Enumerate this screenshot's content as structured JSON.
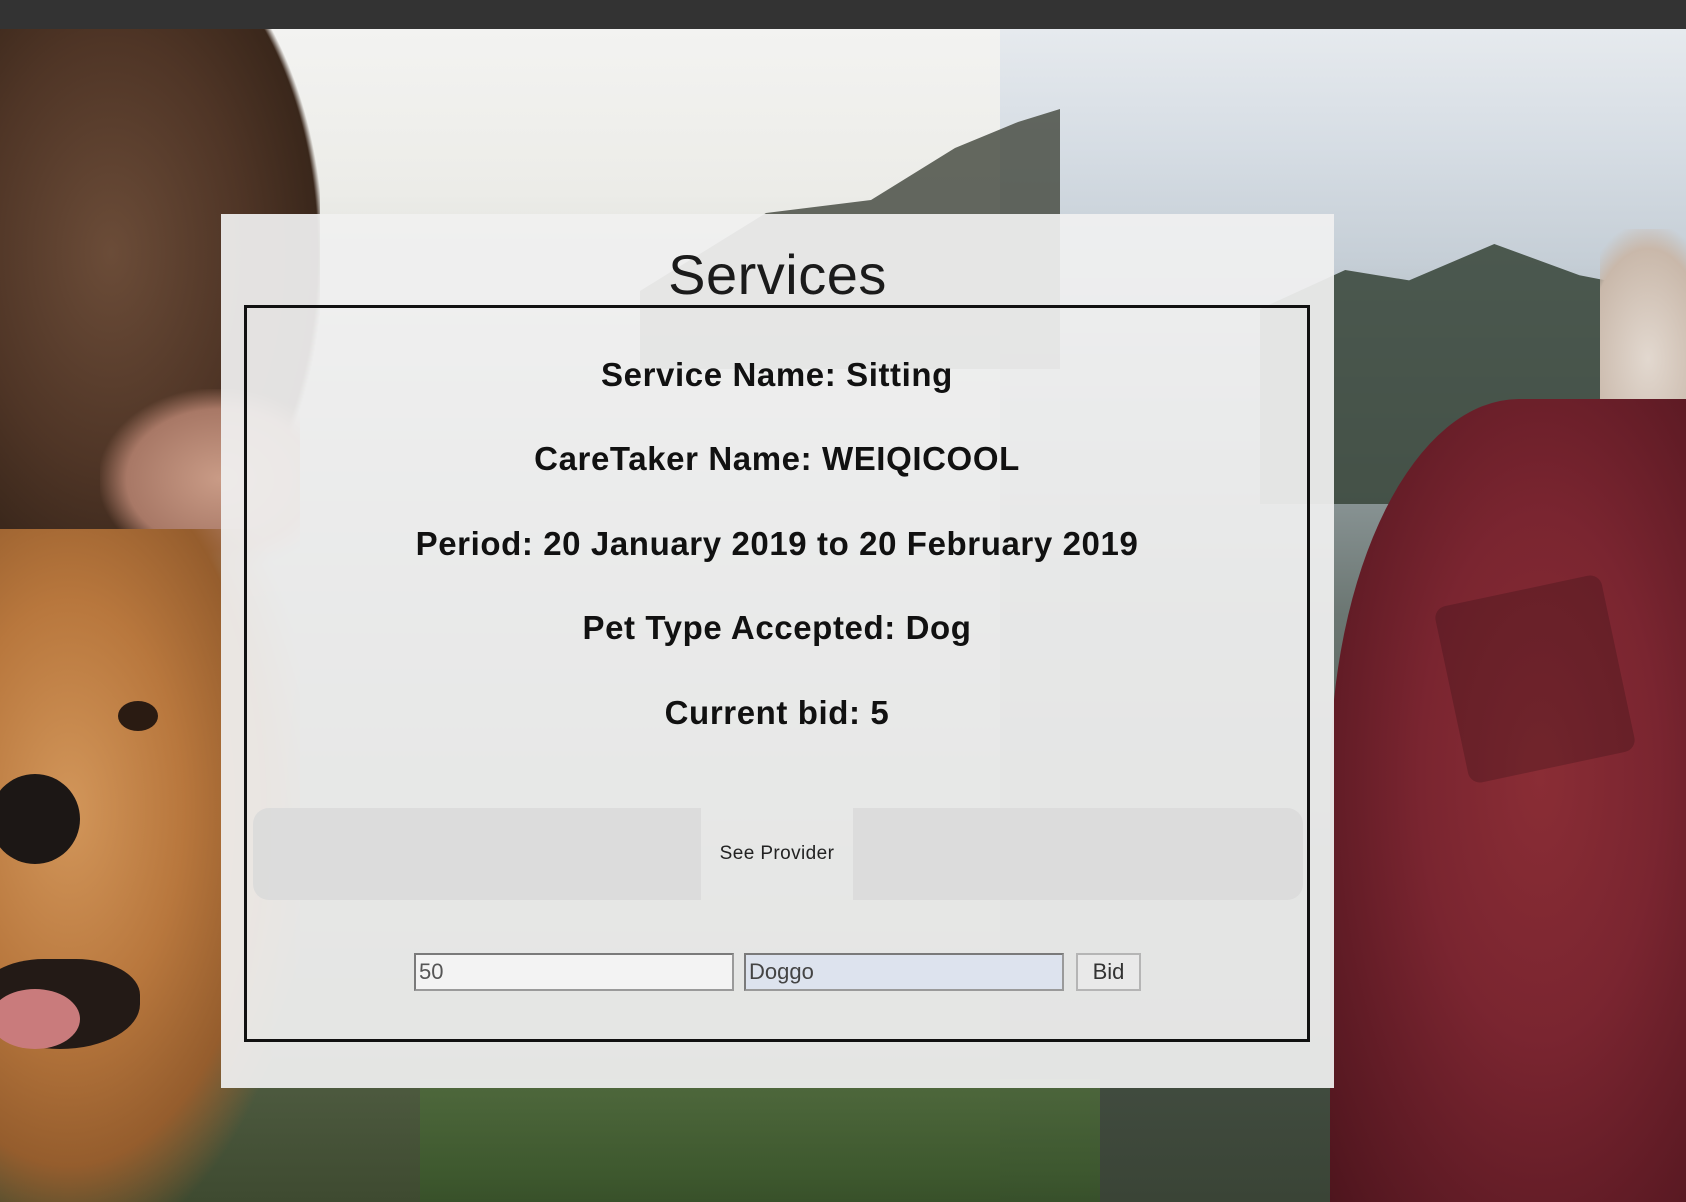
{
  "page": {
    "title": "Services"
  },
  "service": {
    "service_name": "Service Name: Sitting",
    "caretaker_name": "CareTaker Name: WEIQICOOL",
    "period": "Period: 20 January 2019 to 20 February 2019",
    "pet_type": "Pet Type Accepted: Dog",
    "current_bid": "Current bid: 5"
  },
  "actions": {
    "see_provider_label": "See Provider",
    "bid_amount_value": "50",
    "pet_name_value": "Doggo",
    "bid_label": "Bid"
  }
}
